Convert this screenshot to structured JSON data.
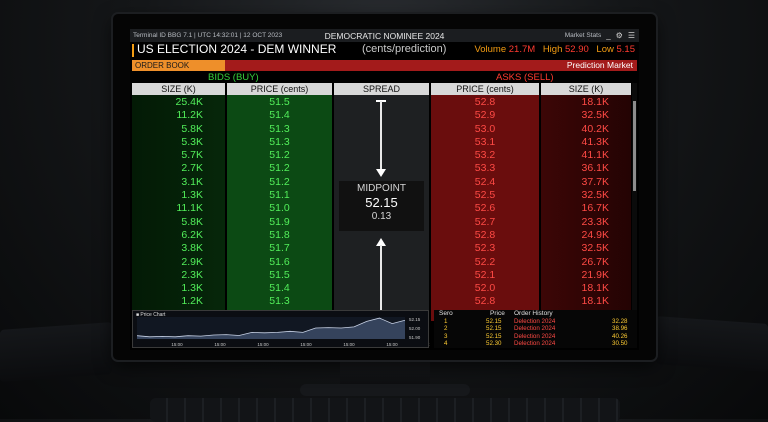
{
  "topbar": {
    "terminal_info": "Terminal ID BBG 7.1 | UTC 14:32:01 | 12 OCT 2023",
    "window_title": "DEMOCRATIC NOMINEE 2024",
    "market_stats_label": "Market Stats",
    "icons": [
      "minimize-icon",
      "gear-icon",
      "grid-menu-icon"
    ]
  },
  "header": {
    "title": "US ELECTION 2024 - DEM WINNER",
    "subtitle": "(cents/prediction)",
    "volume_label": "Volume",
    "volume_value": "21.7M",
    "high_label": "High",
    "high_value": "52.90",
    "low_label": "Low",
    "low_value": "5.15"
  },
  "orderbook": {
    "label": "ORDER BOOK",
    "market_type": "Prediction Market",
    "bids_title": "BIDS (BUY)",
    "asks_title": "ASKS (SELL)",
    "columns": {
      "bid_size": "SIZE (K)",
      "bid_price": "PRICE (cents)",
      "spread": "SPREAD",
      "ask_price": "PRICE (cents)",
      "ask_size": "SIZE (K)"
    },
    "bids": [
      {
        "size": "25.4K",
        "price": "51.5"
      },
      {
        "size": "11.2K",
        "price": "51.4"
      },
      {
        "size": "5.8K",
        "price": "51.3"
      },
      {
        "size": "5.3K",
        "price": "51.3"
      },
      {
        "size": "5.7K",
        "price": "51.2"
      },
      {
        "size": "2.7K",
        "price": "51.2"
      },
      {
        "size": "3.1K",
        "price": "51.2"
      },
      {
        "size": "1.3K",
        "price": "51.1"
      },
      {
        "size": "11.1K",
        "price": "51.0"
      },
      {
        "size": "5.8K",
        "price": "51.9"
      },
      {
        "size": "6.2K",
        "price": "51.8"
      },
      {
        "size": "3.8K",
        "price": "51.7"
      },
      {
        "size": "2.9K",
        "price": "51.6"
      },
      {
        "size": "2.3K",
        "price": "51.5"
      },
      {
        "size": "1.3K",
        "price": "51.4"
      },
      {
        "size": "1.2K",
        "price": "51.3"
      }
    ],
    "asks": [
      {
        "price": "52.8",
        "size": "18.1K"
      },
      {
        "price": "52.9",
        "size": "32.5K"
      },
      {
        "price": "53.0",
        "size": "40.2K"
      },
      {
        "price": "53.1",
        "size": "41.3K"
      },
      {
        "price": "53.2",
        "size": "41.1K"
      },
      {
        "price": "53.3",
        "size": "36.1K"
      },
      {
        "price": "52.4",
        "size": "37.7K"
      },
      {
        "price": "52.5",
        "size": "32.5K"
      },
      {
        "price": "52.6",
        "size": "16.7K"
      },
      {
        "price": "52.7",
        "size": "23.3K"
      },
      {
        "price": "52.8",
        "size": "24.9K"
      },
      {
        "price": "52.3",
        "size": "32.5K"
      },
      {
        "price": "52.2",
        "size": "26.7K"
      },
      {
        "price": "52.1",
        "size": "21.9K"
      },
      {
        "price": "52.0",
        "size": "18.1K"
      },
      {
        "price": "52.8",
        "size": "18.1K"
      }
    ],
    "midpoint_label": "MIDPOINT",
    "midpoint_value": "52.15",
    "spread_value": "0.13"
  },
  "price_chart": {
    "title": "Price Chart",
    "x_ticks": [
      "15:00",
      "15:00",
      "15:00",
      "15:00",
      "15:00",
      "15:00",
      "15:00"
    ],
    "y_ticks": [
      "52.15",
      "52.00",
      "51.90"
    ],
    "series": [
      51.35,
      51.3,
      51.32,
      51.3,
      51.35,
      51.33,
      51.38,
      51.4,
      51.36,
      51.5,
      51.48,
      51.5,
      51.55,
      51.5,
      51.7,
      51.72,
      51.7,
      51.75,
      52.0,
      52.15,
      51.9,
      52.05
    ],
    "line_color": "#c8d2e6"
  },
  "order_history": {
    "columns": [
      "Sero",
      "Price",
      "Order History"
    ],
    "rows": [
      {
        "num": "1",
        "price": "52.15",
        "name": "Delection 2024",
        "amount": "32.28"
      },
      {
        "num": "2",
        "price": "52.15",
        "name": "Delection 2024",
        "amount": "38.96"
      },
      {
        "num": "3",
        "price": "52.15",
        "name": "Delection 2024",
        "amount": "40.26"
      },
      {
        "num": "4",
        "price": "52.30",
        "name": "Delection 2024",
        "amount": "30.50"
      }
    ]
  },
  "colors": {
    "bid_green": "#52ee5a",
    "ask_red": "#ff4a45",
    "accent_orange": "#ee8f2a",
    "header_red": "#a31b1b"
  }
}
